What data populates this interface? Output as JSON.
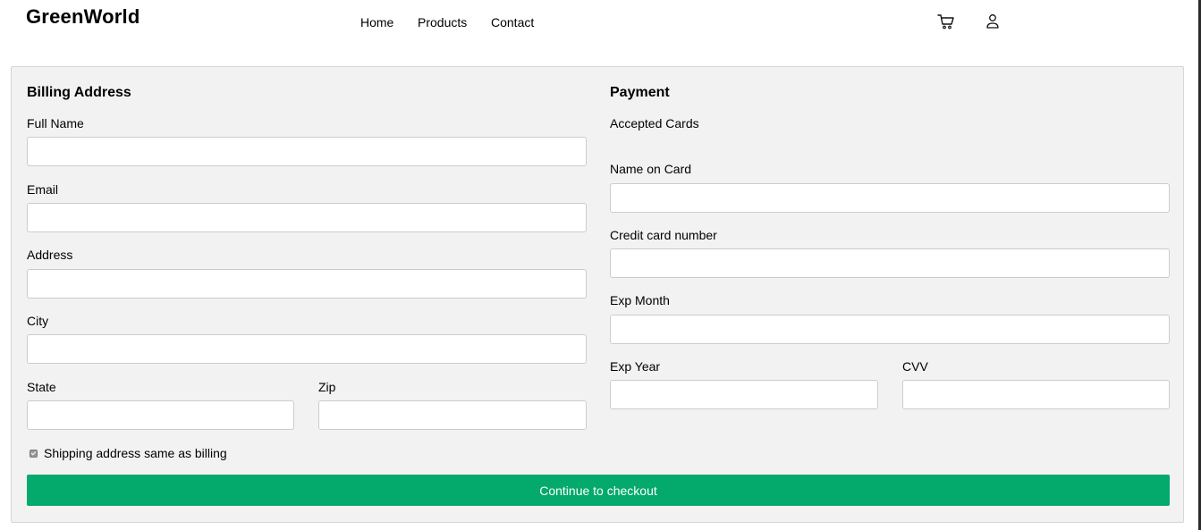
{
  "header": {
    "logo": "GreenWorld",
    "nav": [
      "Home",
      "Products",
      "Contact"
    ],
    "icons": [
      "cart-icon",
      "user-icon"
    ]
  },
  "billing": {
    "heading": "Billing Address",
    "full_name_label": "Full Name",
    "email_label": "Email",
    "address_label": "Address",
    "city_label": "City",
    "state_label": "State",
    "zip_label": "Zip",
    "full_name_value": "",
    "email_value": "",
    "address_value": "",
    "city_value": "",
    "state_value": "",
    "zip_value": ""
  },
  "payment": {
    "heading": "Payment",
    "accepted_cards_label": "Accepted Cards",
    "name_on_card_label": "Name on Card",
    "card_number_label": "Credit card number",
    "exp_month_label": "Exp Month",
    "exp_year_label": "Exp Year",
    "cvv_label": "CVV",
    "name_on_card_value": "",
    "card_number_value": "",
    "exp_month_value": "",
    "exp_year_value": "",
    "cvv_value": ""
  },
  "shipping_same": {
    "label": "Shipping address same as billing",
    "checked": true
  },
  "checkout_button": "Continue to checkout",
  "colors": {
    "accent": "#04a96c",
    "panel_bg": "#f2f2f2"
  }
}
